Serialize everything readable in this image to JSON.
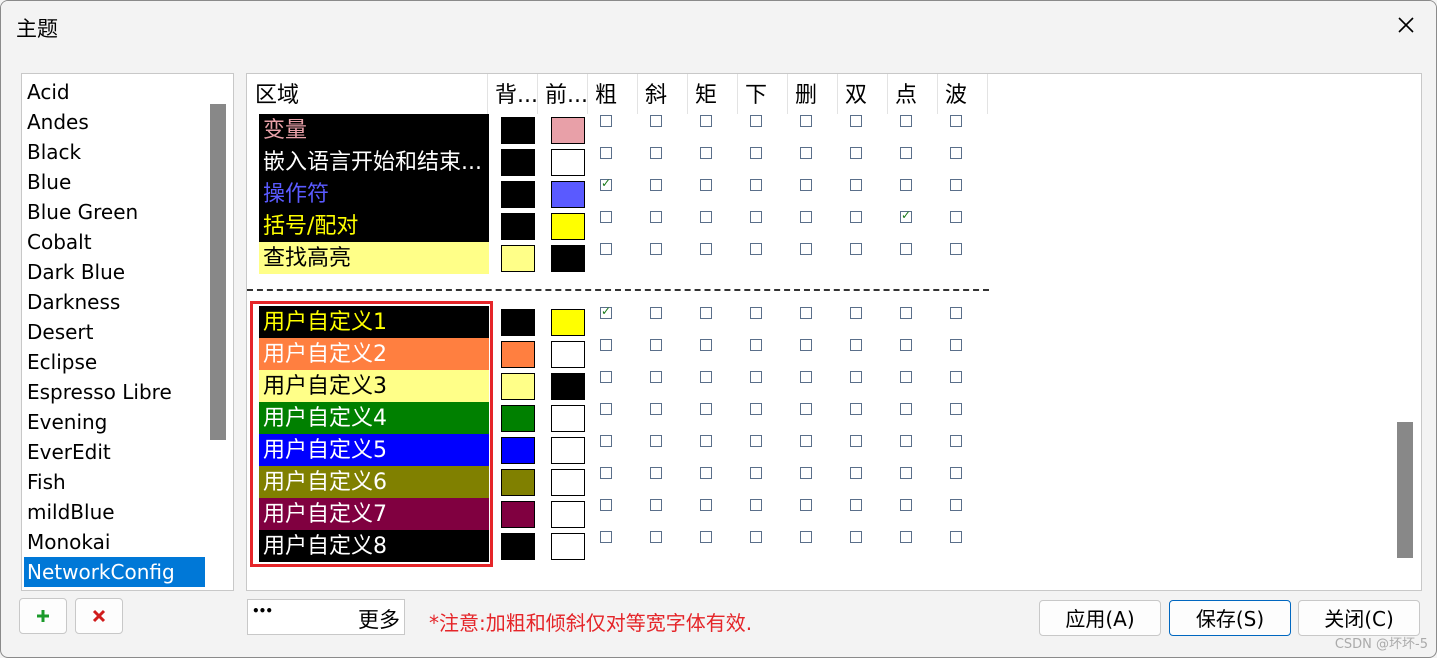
{
  "dialog": {
    "title": "主题"
  },
  "theme_list": {
    "items": [
      "Acid",
      "Andes",
      "Black",
      "Blue",
      "Blue Green",
      "Cobalt",
      "Dark Blue",
      "Darkness",
      "Desert",
      "Eclipse",
      "Espresso Libre",
      "Evening",
      "EverEdit",
      "Fish",
      "mildBlue",
      "Monokai",
      "NetworkConfig"
    ],
    "selected": "NetworkConfig"
  },
  "grid": {
    "headers": {
      "region": "区域",
      "bg": "背...",
      "fg": "前...",
      "styles": [
        "粗",
        "斜",
        "矩",
        "下",
        "删",
        "双",
        "点",
        "波"
      ]
    },
    "rows": [
      {
        "label": "变量",
        "row_bg": "#000000",
        "text_color": "#e8a0a8",
        "bg": "#000000",
        "fg": "#e8a0a8",
        "checks": [
          false,
          false,
          false,
          false,
          false,
          false,
          false,
          false
        ]
      },
      {
        "label": "嵌入语言开始和结束...",
        "row_bg": "#000000",
        "text_color": "#ffffff",
        "bg": "#000000",
        "fg": "#ffffff",
        "checks": [
          false,
          false,
          false,
          false,
          false,
          false,
          false,
          false
        ]
      },
      {
        "label": "操作符",
        "row_bg": "#000000",
        "text_color": "#5a5aff",
        "bg": "#000000",
        "fg": "#5a5aff",
        "checks": [
          true,
          false,
          false,
          false,
          false,
          false,
          false,
          false
        ]
      },
      {
        "label": "括号/配对",
        "row_bg": "#000000",
        "text_color": "#ffff00",
        "bg": "#000000",
        "fg": "#ffff00",
        "checks": [
          false,
          false,
          false,
          false,
          false,
          false,
          true,
          false
        ]
      },
      {
        "label": "查找高亮",
        "row_bg": "#ffff88",
        "text_color": "#000000",
        "bg": "#ffff88",
        "fg": "#000000",
        "checks": [
          false,
          false,
          false,
          false,
          false,
          false,
          false,
          false
        ]
      }
    ],
    "custom_rows": [
      {
        "label": "用户自定义1",
        "row_bg": "#000000",
        "text_color": "#ffff00",
        "bg": "#000000",
        "fg": "#ffff00",
        "checks": [
          true,
          false,
          false,
          false,
          false,
          false,
          false,
          false
        ]
      },
      {
        "label": "用户自定义2",
        "row_bg": "#ff7f40",
        "text_color": "#ffffff",
        "bg": "#ff7f40",
        "fg": "#ffffff",
        "checks": [
          false,
          false,
          false,
          false,
          false,
          false,
          false,
          false
        ]
      },
      {
        "label": "用户自定义3",
        "row_bg": "#ffff88",
        "text_color": "#000000",
        "bg": "#ffff88",
        "fg": "#000000",
        "checks": [
          false,
          false,
          false,
          false,
          false,
          false,
          false,
          false
        ]
      },
      {
        "label": "用户自定义4",
        "row_bg": "#008000",
        "text_color": "#ffffff",
        "bg": "#008000",
        "fg": "#ffffff",
        "checks": [
          false,
          false,
          false,
          false,
          false,
          false,
          false,
          false
        ]
      },
      {
        "label": "用户自定义5",
        "row_bg": "#0000ff",
        "text_color": "#ffffff",
        "bg": "#0000ff",
        "fg": "#ffffff",
        "checks": [
          false,
          false,
          false,
          false,
          false,
          false,
          false,
          false
        ]
      },
      {
        "label": "用户自定义6",
        "row_bg": "#808000",
        "text_color": "#ffffff",
        "bg": "#808000",
        "fg": "#ffffff",
        "checks": [
          false,
          false,
          false,
          false,
          false,
          false,
          false,
          false
        ]
      },
      {
        "label": "用户自定义7",
        "row_bg": "#800040",
        "text_color": "#ffffff",
        "bg": "#800040",
        "fg": "#ffffff",
        "checks": [
          false,
          false,
          false,
          false,
          false,
          false,
          false,
          false
        ]
      },
      {
        "label": "用户自定义8",
        "row_bg": "#000000",
        "text_color": "#ffffff",
        "bg": "#000000",
        "fg": "#ffffff",
        "checks": [
          false,
          false,
          false,
          false,
          false,
          false,
          false,
          false
        ]
      }
    ]
  },
  "bottom": {
    "add_icon": "plus-icon",
    "delete_icon": "x-icon",
    "more_prefix": "•••",
    "more_label": "更多",
    "note": "*注意:加粗和倾斜仅对等宽字体有效.",
    "apply": "应用(A)",
    "save": "保存(S)",
    "close": "关闭(C)",
    "watermark": "CSDN @坏坏-5"
  },
  "colors": {
    "accent": "#0078d7",
    "note_red": "#e52529",
    "add_green": "#1a9a2a",
    "delete_red": "#d01c1c"
  }
}
